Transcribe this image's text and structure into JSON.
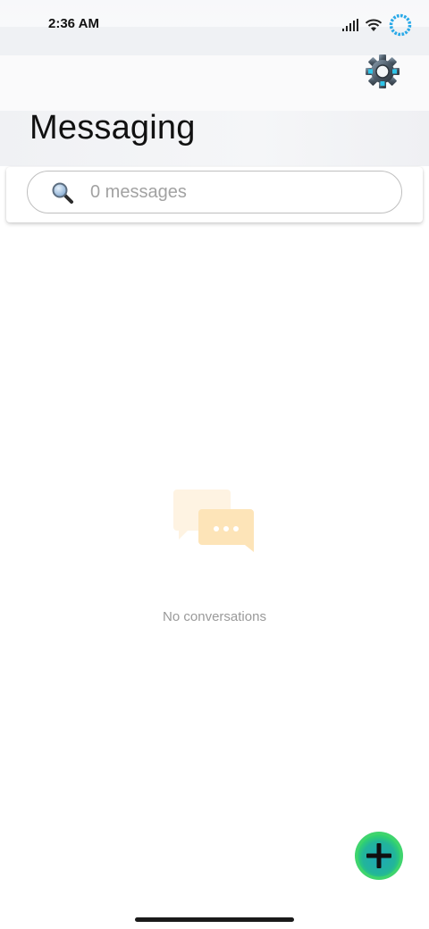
{
  "status_bar": {
    "time": "2:36 AM"
  },
  "header": {
    "title": "Messaging",
    "settings_icon": "gear-icon"
  },
  "search": {
    "placeholder": "0 messages",
    "value": "",
    "icon": "search-icon"
  },
  "empty_state": {
    "icon": "chat-bubbles-icon",
    "text": "No conversations"
  },
  "fab": {
    "icon": "plus-icon",
    "color": "#2ecc71"
  },
  "colors": {
    "accent_green": "#27c35a",
    "empty_icon": "#fde4b8",
    "status_ring": "#29a9e8"
  }
}
